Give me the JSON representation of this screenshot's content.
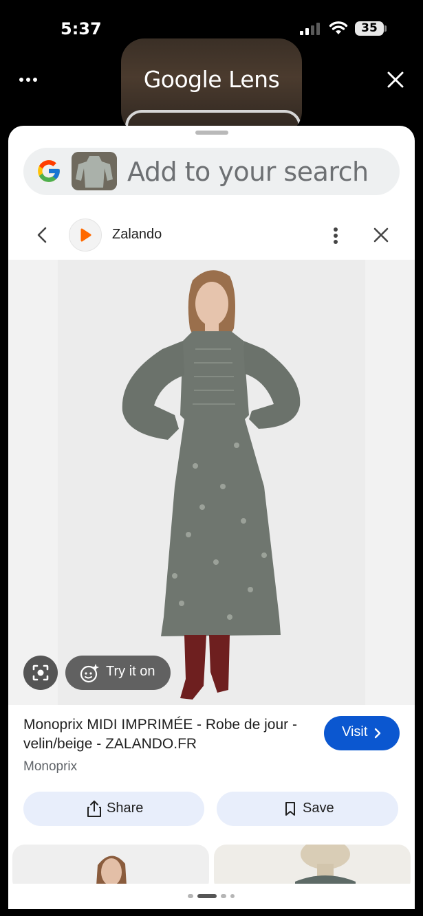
{
  "status_bar": {
    "time": "5:37",
    "battery": "35"
  },
  "lens_header": {
    "title": "Google Lens"
  },
  "search": {
    "placeholder": "Add to your search"
  },
  "site": {
    "name": "Zalando"
  },
  "image_actions": {
    "try_on_label": "Try it on"
  },
  "product": {
    "title": "Monoprix MIDI IMPRIMÉE - Robe de jour - velin/beige - ZALANDO.FR",
    "source": "Monoprix",
    "visit_label": "Visit",
    "share_label": "Share",
    "save_label": "Save"
  },
  "pager": {
    "active_index": 1,
    "count": 4
  },
  "colors": {
    "accent_blue": "#0b57d0",
    "action_bg": "#e8eefb",
    "tryon_bg": "#616161",
    "zalando_orange": "#ff6900"
  }
}
